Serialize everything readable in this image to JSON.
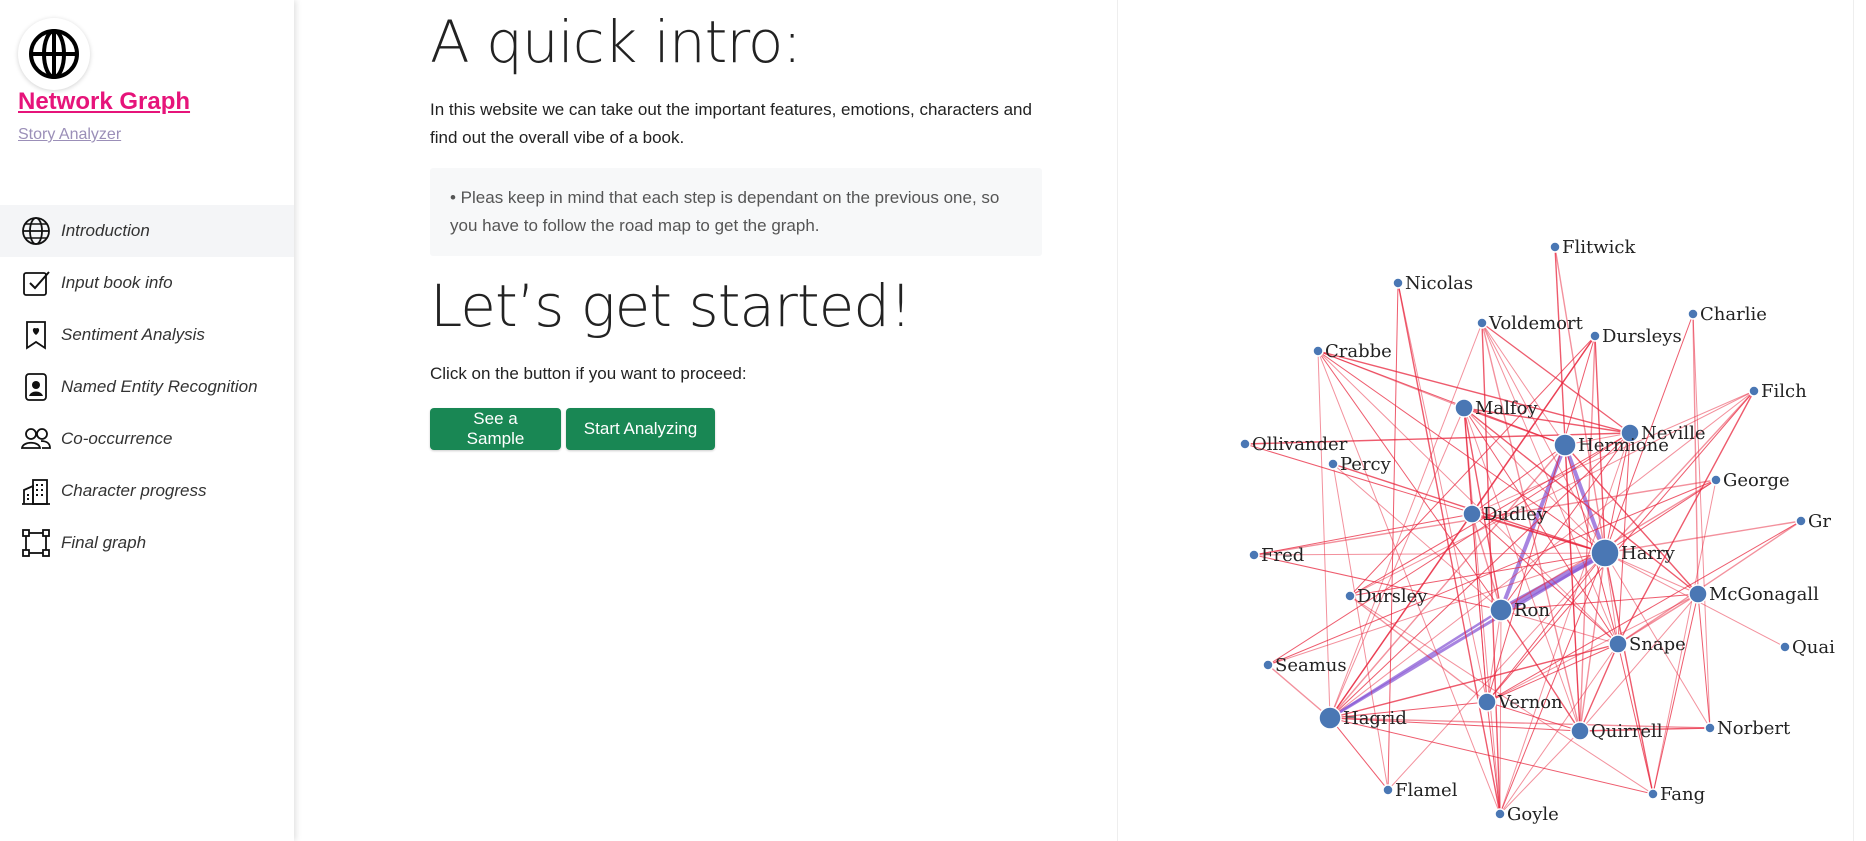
{
  "sidebar": {
    "brand_title": "Network Graph",
    "brand_subtitle": "Story Analyzer",
    "logo_icon": "globe-icon",
    "items": [
      {
        "label": "Introduction",
        "icon": "globe-icon",
        "active": true
      },
      {
        "label": "Input book info",
        "icon": "checkbox-icon",
        "active": false
      },
      {
        "label": "Sentiment Analysis",
        "icon": "bookmark-heart-icon",
        "active": false
      },
      {
        "label": "Named Entity Recognition",
        "icon": "person-badge-icon",
        "active": false
      },
      {
        "label": "Co-occurrence",
        "icon": "people-icon",
        "active": false
      },
      {
        "label": "Character progress",
        "icon": "buildings-icon",
        "active": false
      },
      {
        "label": "Final graph",
        "icon": "bounding-box-icon",
        "active": false
      }
    ]
  },
  "main": {
    "intro_title": "A quick intro:",
    "intro_text": "In this website we can take out the important features, emotions, characters and find out the overall vibe of a book.",
    "note_text": "• Pleas keep in mind that each step is dependant on the previous one, so you have to follow the road map to get the graph.",
    "start_title": "Let’s get started!",
    "proceed_text": "Click on the button if you want to proceed:",
    "buttons": {
      "sample": "See a Sample",
      "start": "Start Analyzing"
    }
  },
  "colors": {
    "brand": "#e6147a",
    "button": "#198754",
    "node": "#4a77b4",
    "edge": "#e8243c",
    "edge_strong": "#8a5bd6"
  },
  "graph": {
    "nodes": [
      {
        "name": "Flitwick",
        "size": "small"
      },
      {
        "name": "Nicolas",
        "size": "small"
      },
      {
        "name": "Voldemort",
        "size": "small"
      },
      {
        "name": "Dursleys",
        "size": "small"
      },
      {
        "name": "Charlie",
        "size": "small"
      },
      {
        "name": "Crabbe",
        "size": "small"
      },
      {
        "name": "Filch",
        "size": "small"
      },
      {
        "name": "Malfoy",
        "size": "medium"
      },
      {
        "name": "Neville",
        "size": "medium"
      },
      {
        "name": "Hermione",
        "size": "large"
      },
      {
        "name": "Ollivander",
        "size": "small"
      },
      {
        "name": "Percy",
        "size": "small"
      },
      {
        "name": "George",
        "size": "small"
      },
      {
        "name": "Dudley",
        "size": "medium"
      },
      {
        "name": "Gr",
        "size": "small"
      },
      {
        "name": "Harry",
        "size": "xlarge"
      },
      {
        "name": "Fred",
        "size": "small"
      },
      {
        "name": "McGonagall",
        "size": "medium"
      },
      {
        "name": "Dursley",
        "size": "small"
      },
      {
        "name": "Ron",
        "size": "large"
      },
      {
        "name": "Snape",
        "size": "medium"
      },
      {
        "name": "Quai",
        "size": "small"
      },
      {
        "name": "Seamus",
        "size": "small"
      },
      {
        "name": "Vernon",
        "size": "medium"
      },
      {
        "name": "Hagrid",
        "size": "large"
      },
      {
        "name": "Quirrell",
        "size": "medium"
      },
      {
        "name": "Norbert",
        "size": "small"
      },
      {
        "name": "Flamel",
        "size": "small"
      },
      {
        "name": "Fang",
        "size": "small"
      },
      {
        "name": "Goyle",
        "size": "small"
      }
    ]
  }
}
